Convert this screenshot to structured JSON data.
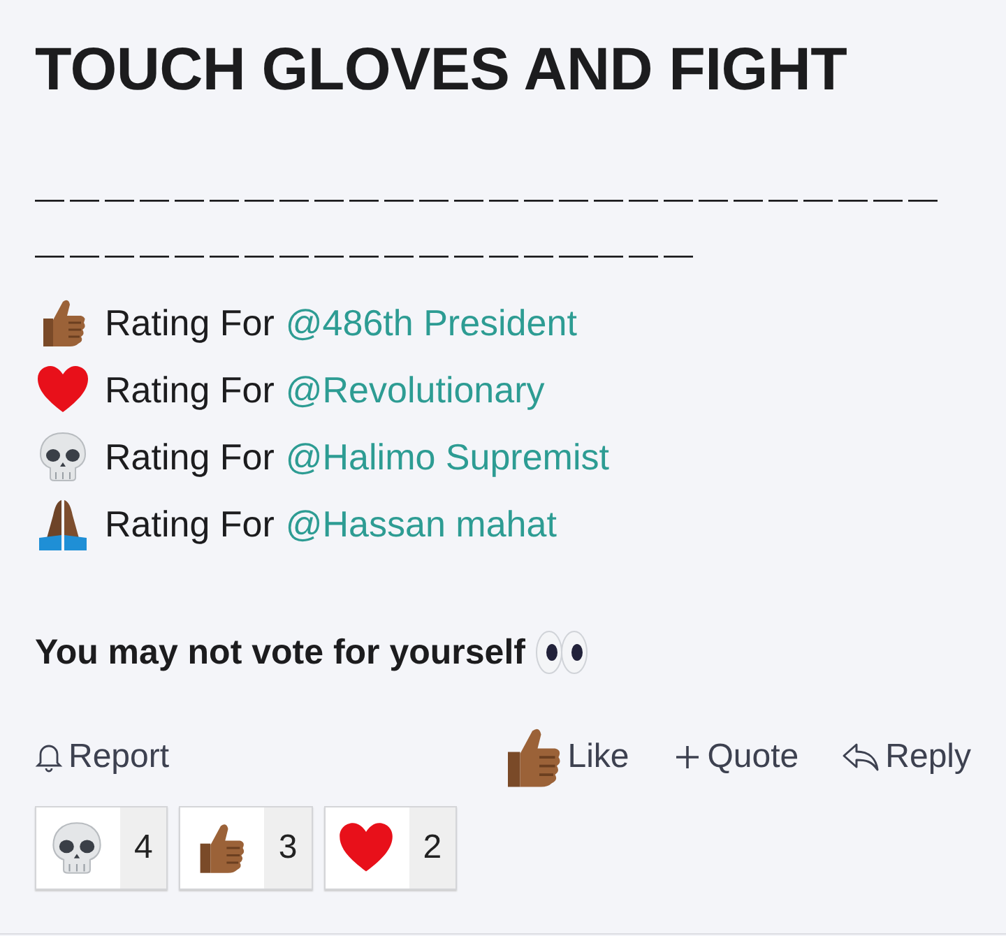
{
  "post": {
    "title": "TOUCH GLOVES AND FIGHT",
    "divider_lines": [
      "——————————————————————————",
      "———————————————————"
    ],
    "ratings": [
      {
        "kind": "thumbs_up",
        "label": "Rating For",
        "mention": "@486th President"
      },
      {
        "kind": "heart",
        "label": "Rating For",
        "mention": "@Revolutionary"
      },
      {
        "kind": "skull",
        "label": "Rating For",
        "mention": "@Halimo Supremist"
      },
      {
        "kind": "pray",
        "label": "Rating For",
        "mention": "@Hassan mahat"
      }
    ],
    "note": {
      "text": "You may not vote for yourself",
      "kind": "eyes"
    }
  },
  "actions": [
    {
      "kind": "report",
      "label": "Report"
    },
    {
      "kind": "like",
      "label": "Like"
    },
    {
      "kind": "quote",
      "label": "Quote"
    },
    {
      "kind": "reply",
      "label": "Reply"
    }
  ],
  "reactions": [
    {
      "kind": "skull",
      "count": "4"
    },
    {
      "kind": "thumbs_up",
      "count": "3"
    },
    {
      "kind": "heart",
      "count": "2"
    }
  ]
}
